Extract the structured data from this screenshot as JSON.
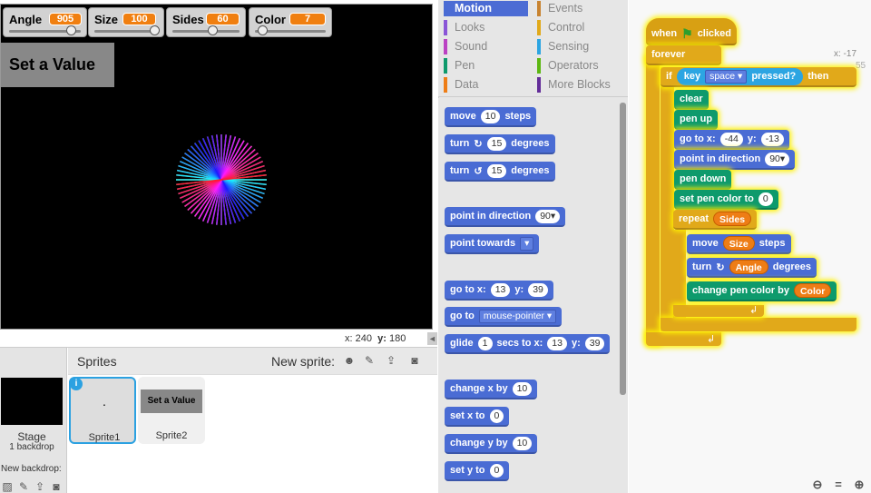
{
  "monitors": [
    {
      "label": "Angle",
      "value": "905",
      "fraction": 0.9
    },
    {
      "label": "Size",
      "value": "100",
      "fraction": 1.0
    },
    {
      "label": "Sides",
      "value": "60",
      "fraction": 0.6
    },
    {
      "label": "Color",
      "value": "7",
      "fraction": 0.05
    }
  ],
  "stage": {
    "button_text": "Set a Value",
    "mouse_x_label": "x:",
    "mouse_x": "240",
    "mouse_y_label": "y:",
    "mouse_y": "180",
    "collapse": "◄"
  },
  "sprites_panel": {
    "title": "Sprites",
    "new_sprite": "New sprite:",
    "stage_title": "Stage",
    "stage_sub": "1 backdrop",
    "new_backdrop": "New backdrop:",
    "sprites": [
      {
        "name": "Sprite1",
        "thumb_text": "·"
      },
      {
        "name": "Sprite2",
        "thumb_text": "Set a Value"
      }
    ]
  },
  "categories": [
    {
      "label": "Motion",
      "color": "#4a6cd4",
      "active": true
    },
    {
      "label": "Looks",
      "color": "#8a55d7"
    },
    {
      "label": "Sound",
      "color": "#bb42c3"
    },
    {
      "label": "Pen",
      "color": "#0e9a6c"
    },
    {
      "label": "Data",
      "color": "#ee7d16"
    },
    {
      "label": "Events",
      "color": "#c88330"
    },
    {
      "label": "Control",
      "color": "#e1a91a"
    },
    {
      "label": "Sensing",
      "color": "#2ca5e2"
    },
    {
      "label": "Operators",
      "color": "#5cb712"
    },
    {
      "label": "More Blocks",
      "color": "#632d99"
    }
  ],
  "palette": {
    "move": {
      "a": "move",
      "n": "10",
      "b": "steps"
    },
    "turn_cw": {
      "a": "turn",
      "n": "15",
      "b": "degrees"
    },
    "turn_ccw": {
      "a": "turn",
      "n": "15",
      "b": "degrees"
    },
    "point_dir": {
      "a": "point in direction",
      "n": "90▾"
    },
    "point_towards": {
      "a": "point towards"
    },
    "goto_xy": {
      "a": "go to x:",
      "x": "13",
      "b": "y:",
      "y": "39"
    },
    "goto": {
      "a": "go to",
      "d": "mouse-pointer ▾"
    },
    "glide": {
      "a": "glide",
      "n": "1",
      "b": "secs to x:",
      "x": "13",
      "c": "y:",
      "y": "39"
    },
    "change_x": {
      "a": "change x by",
      "n": "10"
    },
    "set_x": {
      "a": "set x to",
      "n": "0"
    },
    "change_y": {
      "a": "change y by",
      "n": "10"
    },
    "set_y": {
      "a": "set y to",
      "n": "0"
    }
  },
  "script": {
    "hat_a": "when",
    "hat_b": "clicked",
    "forever": "forever",
    "if": "if",
    "key": "key",
    "key_val": "space ▾",
    "pressed": "pressed?",
    "then": "then",
    "clear": "clear",
    "pen_up": "pen up",
    "goto_a": "go to x:",
    "goto_x": "-44",
    "goto_b": "y:",
    "goto_y": "-13",
    "point_a": "point in direction",
    "point_v": "90▾",
    "pen_down": "pen down",
    "setcolor_a": "set pen color to",
    "setcolor_v": "0",
    "repeat": "repeat",
    "repeat_v": "Sides",
    "move_a": "move",
    "move_v": "Size",
    "move_b": "steps",
    "turn_a": "turn",
    "turn_v": "Angle",
    "turn_b": "degrees",
    "chgcolor_a": "change pen color by",
    "chgcolor_v": "Color",
    "xy_x": "x: -17",
    "xy_y": "55"
  }
}
